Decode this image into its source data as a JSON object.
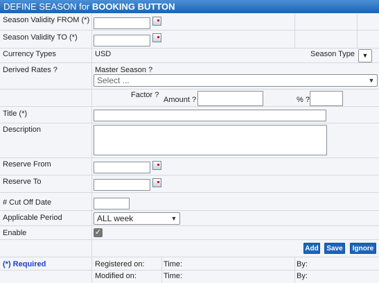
{
  "title": {
    "prefix": "DEFINE SEASON for",
    "name": "BOOKING BUTTON"
  },
  "fields": {
    "season_from_label": "Season Validity FROM (*)",
    "season_to_label": "Season Validity TO (*)",
    "currency_label": "Currency Types",
    "currency_value": "USD",
    "season_type_label": "Season Type",
    "derived_rates_label": "Derived Rates ?",
    "master_season_label": "Master Season ?",
    "master_season_value": "Select ...",
    "factor_label": "Factor ?",
    "amount_label": "Amount ?",
    "percent_label": "% ?",
    "title_label": "Title (*)",
    "description_label": "Description",
    "reserve_from_label": "Reserve From",
    "reserve_to_label": "Reserve To",
    "cutoff_label": "# Cut Off Date",
    "applicable_period_label": "Applicable Period",
    "applicable_period_value": "ALL week",
    "enable_label": "Enable",
    "enable_checked": true
  },
  "buttons": {
    "add": "Add",
    "save": "Save",
    "ignore": "Ignore"
  },
  "footer": {
    "required_note": "(*) Required",
    "registered_on": "Registered on:",
    "modified_on": "Modified on:",
    "time": "Time:",
    "by": "By:"
  },
  "colors": {
    "title_bar": "#1b63b3",
    "button": "#1d64ba",
    "required_text": "#1f3fc2"
  }
}
